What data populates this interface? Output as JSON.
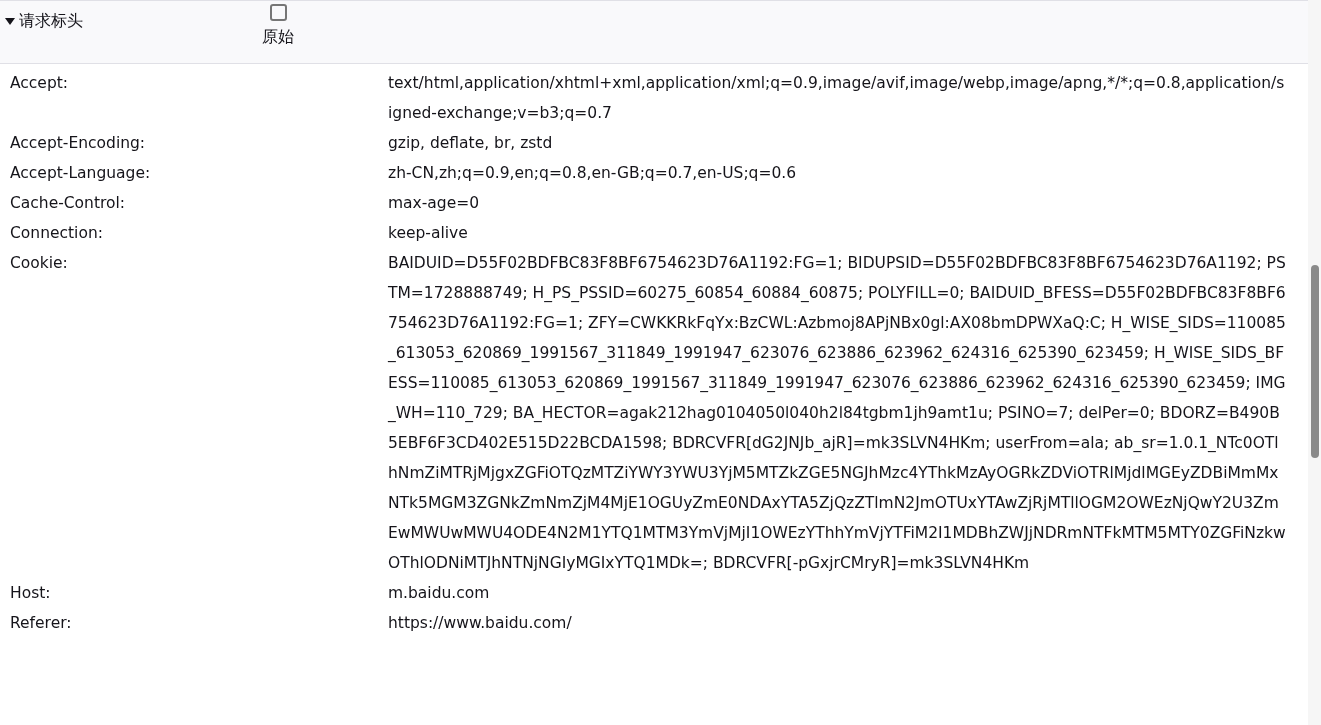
{
  "section": {
    "title": "请求标头",
    "expanded": true,
    "raw": {
      "label": "原始",
      "checked": false
    }
  },
  "headers": [
    {
      "name": "Accept:",
      "value": "text/html,application/xhtml+xml,application/xml;q=0.9,image/avif,image/webp,image/apng,*/*;q=0.8,application/signed-exchange;v=b3;q=0.7"
    },
    {
      "name": "Accept-Encoding:",
      "value": "gzip, deflate, br, zstd"
    },
    {
      "name": "Accept-Language:",
      "value": "zh-CN,zh;q=0.9,en;q=0.8,en-GB;q=0.7,en-US;q=0.6"
    },
    {
      "name": "Cache-Control:",
      "value": "max-age=0"
    },
    {
      "name": "Connection:",
      "value": "keep-alive"
    },
    {
      "name": "Cookie:",
      "value": "BAIDUID=D55F02BDFBC83F8BF6754623D76A1192:FG=1; BIDUPSID=D55F02BDFBC83F8BF6754623D76A1192; PSTM=1728888749; H_PS_PSSID=60275_60854_60884_60875; POLYFILL=0; BAIDUID_BFESS=D55F02BDFBC83F8BF6754623D76A1192:FG=1; ZFY=CWKKRkFqYx:BzCWL:Azbmoj8APjNBx0gl:AX08bmDPWXaQ:C; H_WISE_SIDS=110085_613053_620869_1991567_311849_1991947_623076_623886_623962_624316_625390_623459; H_WISE_SIDS_BFESS=110085_613053_620869_1991567_311849_1991947_623076_623886_623962_624316_625390_623459; IMG_WH=110_729; BA_HECTOR=agak212hag0104050l040h2l84tgbm1jh9amt1u; PSINO=7; delPer=0; BDORZ=B490B5EBF6F3CD402E515D22BCDA1598; BDRCVFR[dG2JNJb_ajR]=mk3SLVN4HKm; userFrom=ala; ab_sr=1.0.1_NTc0OTlhNmZiMTRjMjgxZGFiOTQzMTZiYWY3YWU3YjM5MTZkZGE5NGJhMzc4YThkMzAyOGRkZDViOTRlMjdlMGEyZDBiMmMxNTk5MGM3ZGNkZmNmZjM4MjE1OGUyZmE0NDAxYTA5ZjQzZTlmN2JmOTUxYTAwZjRjMTllOGM2OWEzNjQwY2U3ZmEwMWUwMWU4ODE4N2M1YTQ1MTM3YmVjMjI1OWEzYThhYmVjYTFiM2I1MDBhZWJjNDRmNTFkMTM5MTY0ZGFiNzkwOThlODNiMTJhNTNjNGIyMGIxYTQ1MDk=; BDRCVFR[-pGxjrCMryR]=mk3SLVN4HKm"
    },
    {
      "name": "Host:",
      "value": "m.baidu.com"
    },
    {
      "name": "Referer:",
      "value": "https://www.baidu.com/"
    }
  ]
}
